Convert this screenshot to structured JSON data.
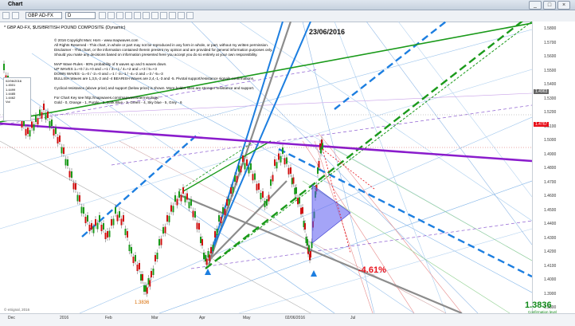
{
  "window": {
    "title": "Chart"
  },
  "toolbar": {
    "symbol": "GBP AD-FX",
    "period": "D"
  },
  "chart_header": "* GBP AD-FX, $US/BRITISH POUND COMPOSITE (Dynamic)",
  "notes": [
    "© 2016 Copyright Marc Horn - www.mapwaves.com",
    "All Rights Reserved - This chart, in whole or part may not be reproduced in any form in whole, or part, without my written permission.",
    "Disclaimer - This chart, or the information contained therein present my opinion and are provided for general information purposes only.",
    "Should you make any decisions based on information presented here you accept you do so entirely at your own responsibility.",
    "",
    "MAP Wave Rules - 80% probability of 5 waves up and 5 waves down.",
    "UP WAVES      1=+0  /  2=+0 and =+1  /  3=+1  /  4=+2 and =+3  /  5=+3",
    "DOWN WAVES   -1=-0  /  -2=-0 and =-1  /  -3=-1  /  -4=-2 and =-3  /  -5=-3",
    "BULLISH Waves are 1,3,5,-2 and -4    BEARISH Waves are 2,4,-1,-3 and -5. Pivotal support/resistance signals confirmations.",
    "",
    "Cyclical resistance (above price) and support (below price) is shown. More bolder lines are stronger resistance and support.",
    "",
    "For Chart Key see http://mapwaves.com/mapwaves/terminology/",
    "Gold - 0, Orange - 1, Purple - 2, Dark Blue - 3, Green - 4, Sky blue - 5, Grey - 6"
  ],
  "date_label": "23/06/2016",
  "price_ticks": [
    "1.5800",
    "1.5700",
    "1.5600",
    "1.5500",
    "1.5400",
    "1.5300",
    "1.5200",
    "1.5100",
    "1.5000",
    "1.4900",
    "1.4800",
    "1.4700",
    "1.4600",
    "1.4500",
    "1.4400",
    "1.4300",
    "1.4200",
    "1.4100",
    "1.4000",
    "1.3900",
    "1.3800"
  ],
  "current_price": "1.4767",
  "level_price": "1.4963",
  "low_level": "1.3836",
  "low_label": "1.3836",
  "confirmation_label": "Confirmation level",
  "percent_change": "-4.61%",
  "x_labels": [
    "Dec",
    "2016",
    "Feb",
    "Mar",
    "Apr",
    "May",
    "02/06/2016",
    "Jul"
  ],
  "mini_box": [
    "02/06/2016",
    "1.4501",
    "1.4499",
    "1.4485",
    "1.4462",
    "Vol"
  ],
  "footer": "© eSignal, 2016",
  "colors": {
    "purple": "#8a1ccc",
    "green": "#1a9a1a",
    "blue": "#1c7ee0",
    "grey": "#8a8a8a",
    "red": "#e8101a",
    "triangle": "#4a4ae8"
  },
  "chart_data": {
    "type": "candlestick",
    "title": "",
    "y_range": [
      1.3836,
      1.58
    ],
    "x_categories": [
      "Dec",
      "2016",
      "Feb",
      "Mar",
      "Apr",
      "May",
      "02/06/2016",
      "Jul"
    ],
    "annotations": [
      "23/06/2016",
      "-4.61%",
      "1.3836"
    ]
  }
}
